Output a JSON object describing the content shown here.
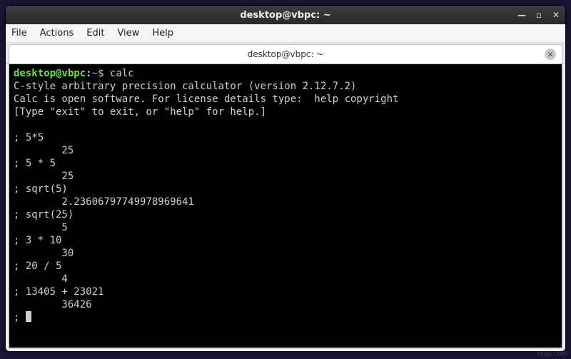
{
  "window": {
    "title": "desktop@vbpc: ~"
  },
  "menu": {
    "file": "File",
    "actions": "Actions",
    "edit": "Edit",
    "view": "View",
    "help": "Help"
  },
  "tab": {
    "label": "desktop@vbpc: ~"
  },
  "prompt": {
    "user": "desktop@vbpc",
    "path": "~",
    "symbol": "$"
  },
  "session": {
    "command": "calc",
    "banner1": "C-style arbitrary precision calculator (version 2.12.7.2)",
    "banner2": "Calc is open software. For license details type:  help copyright",
    "banner3": "[Type \"exit\" to exit, or \"help\" for help.]",
    "lines": [
      {
        "in": "5*5",
        "out": "25"
      },
      {
        "in": "5 * 5",
        "out": "25"
      },
      {
        "in": "sqrt(5)",
        "out": "2.23606797749978969641"
      },
      {
        "in": "sqrt(25)",
        "out": "5"
      },
      {
        "in": "3 * 10",
        "out": "30"
      },
      {
        "in": "20 / 5",
        "out": "4"
      },
      {
        "in": "13405 + 23021",
        "out": "36426"
      }
    ],
    "calc_prompt": ";"
  },
  "watermark": "vsxp.com"
}
